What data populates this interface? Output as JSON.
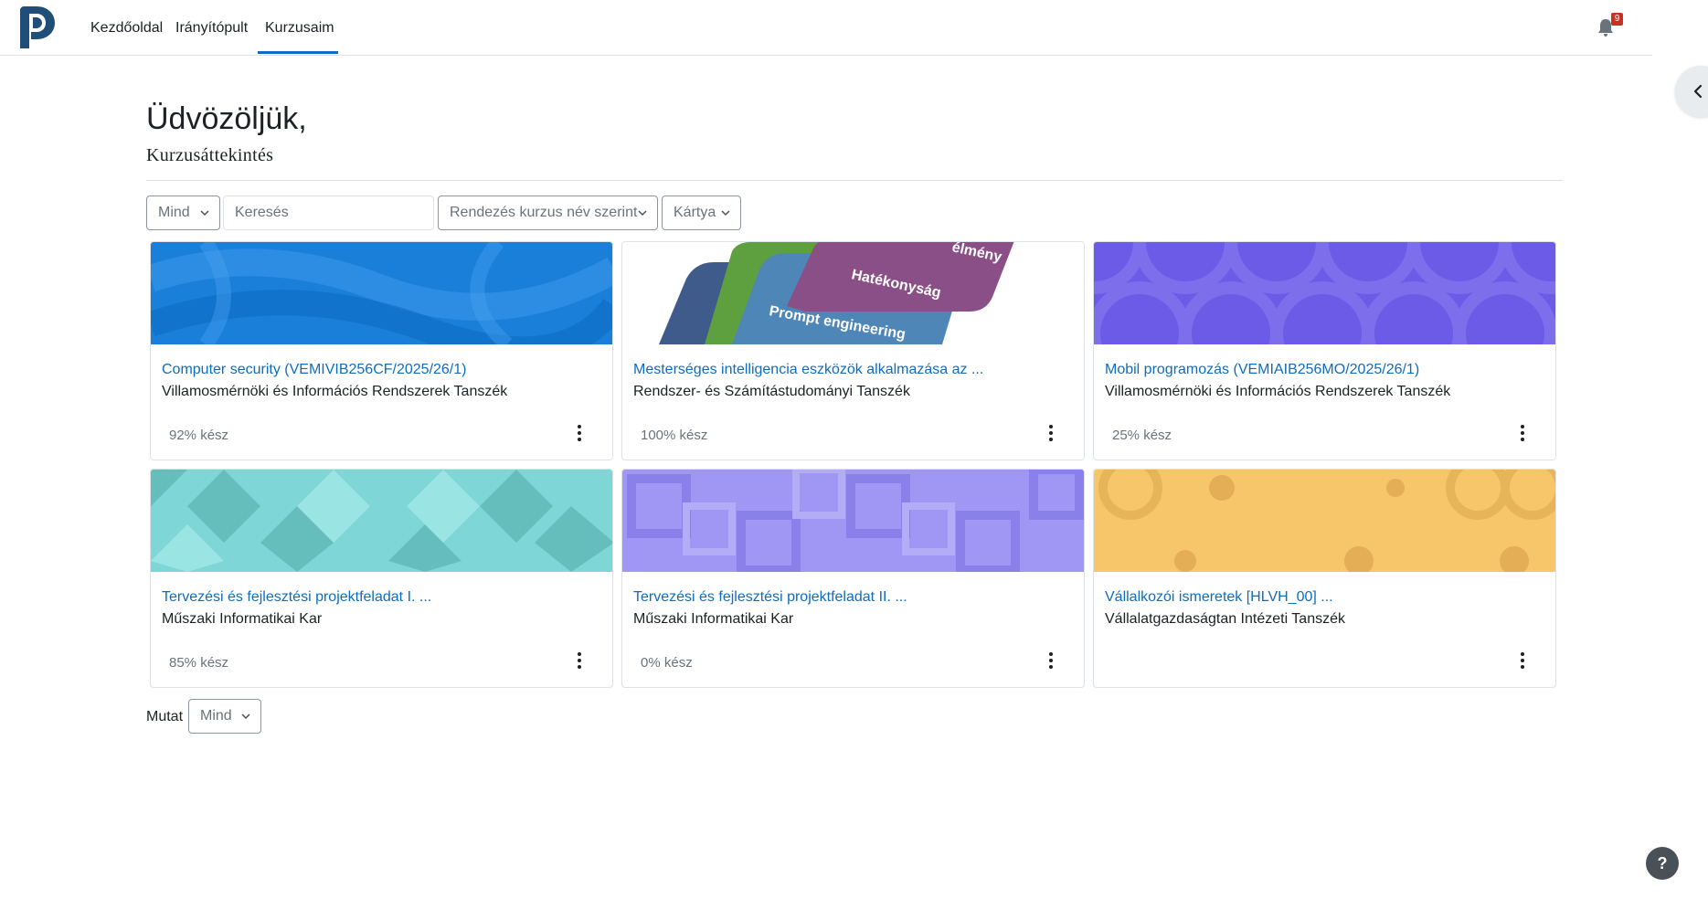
{
  "nav": {
    "items": [
      {
        "label": "Kezdőoldal"
      },
      {
        "label": "Irányítópult"
      },
      {
        "label": "Kurzusaim"
      }
    ],
    "notification_count": "9"
  },
  "page": {
    "welcome": "Üdvözöljük,",
    "overview_title": "Kurzusáttekintés"
  },
  "filters": {
    "grouping": "Mind",
    "search_placeholder": "Keresés",
    "sort": "Rendezés kurzus név szerint",
    "view": "Kártya"
  },
  "courses": [
    {
      "title": "Computer security (VEMIVIB256CF/2025/26/1)",
      "department": "Villamosmérnöki és Információs Rendszerek Tanszék",
      "progress": "92% kész",
      "image_color": "#1a7fd9"
    },
    {
      "title": "Mesterséges intelligencia eszközök alkalmazása az ...",
      "department": "Rendszer- és Számítástudományi Tanszék",
      "progress": "100% kész",
      "image_text": [
        "Hatékonyság",
        "Prompt engineering",
        "élmény"
      ]
    },
    {
      "title": "Mobil programozás (VEMIAIB256MO/2025/26/1)",
      "department": "Villamosmérnöki és Információs Rendszerek Tanszék",
      "progress": "25% kész",
      "image_color": "#6b5be6"
    },
    {
      "title": "Tervezési és fejlesztési projektfeladat I. ...",
      "department": "Műszaki Informatikai Kar",
      "progress": "85% kész",
      "image_color": "#7fd6d6"
    },
    {
      "title": "Tervezési és fejlesztési projektfeladat II. ...",
      "department": "Műszaki Informatikai Kar",
      "progress": "0% kész",
      "image_color": "#9f97f3"
    },
    {
      "title": "Vállalkozói ismeretek [HLVH_00] ...",
      "department": "Vállalatgazdaságtan Intézeti Tanszék",
      "progress": "",
      "image_color": "#f7c66a"
    }
  ],
  "footer": {
    "show_label": "Mutat",
    "show_value": "Mind",
    "help_label": "?"
  },
  "colors": {
    "accent": "#0f6cbf",
    "badge": "#ca3120"
  }
}
